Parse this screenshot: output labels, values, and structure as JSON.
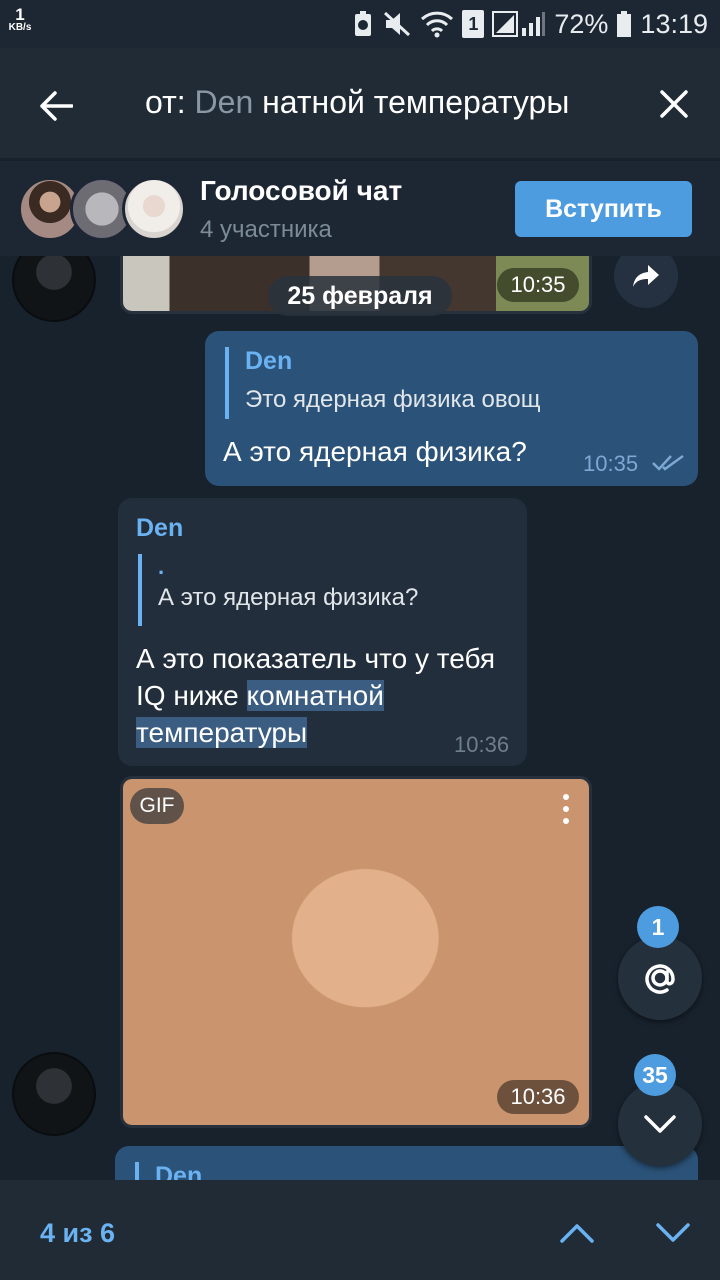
{
  "status_bar": {
    "speed_value": "1",
    "speed_unit": "KB/s",
    "sim_badge": "1",
    "battery": "72%",
    "time": "13:19"
  },
  "search": {
    "prefix": "от: ",
    "user": "Den",
    "query": "натной температуры"
  },
  "voice_chat": {
    "title": "Голосовой чат",
    "participants": "4 участника",
    "join_label": "Вступить"
  },
  "messages": {
    "media_top": {
      "date": "25 февраля",
      "time": "10:35"
    },
    "outgoing": {
      "reply_name": "Den",
      "reply_text": "Это ядерная физика овощ",
      "text": "А это ядерная физика?",
      "time": "10:35"
    },
    "incoming": {
      "sender": "Den",
      "reply_line1": ".",
      "reply_text": "А это ядерная физика?",
      "text_part1": "А это показатель что у тебя IQ ниже ",
      "text_highlight1": "комнатной",
      "text_highlight2": "температуры",
      "time": "10:36"
    },
    "gif": {
      "badge": "GIF",
      "time": "10:36"
    },
    "next_reply_name": "Den"
  },
  "fabs": {
    "mention_badge": "1",
    "scroll_badge": "35"
  },
  "bottom_bar": {
    "counter": "4 из 6"
  }
}
